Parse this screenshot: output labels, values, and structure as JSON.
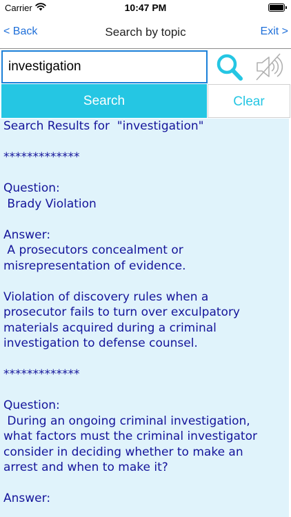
{
  "status_bar": {
    "carrier": "Carrier",
    "time": "10:47 PM"
  },
  "nav": {
    "back_label": "< Back",
    "title": "Search by topic",
    "exit_label": "Exit >"
  },
  "search": {
    "query": "investigation",
    "search_icon": "magnifier-icon",
    "mute_icon": "speaker-muted-icon"
  },
  "actions": {
    "search_label": "Search",
    "clear_label": "Clear"
  },
  "results": {
    "heading": "Search Results for  \"investigation\"",
    "separator": "*************",
    "question_label": "Question:",
    "answer_label": "Answer:",
    "items": [
      {
        "question": " Brady Violation",
        "answer_1": " A prosecutors concealment or\nmisrepresentation of evidence.",
        "answer_2": "Violation of discovery rules when a\nprosecutor fails to turn over exculpatory\nmaterials acquired during a criminal\ninvestigation to defense counsel."
      },
      {
        "question": " During an ongoing criminal investigation,\nwhat factors must the criminal investigator\nconsider in deciding whether to make an\narrest and when to make it?"
      }
    ]
  },
  "colors": {
    "accent": "#25c6e3",
    "link": "#1e6fd9",
    "result_text": "#14149a",
    "result_bg": "#e0f3fb"
  }
}
